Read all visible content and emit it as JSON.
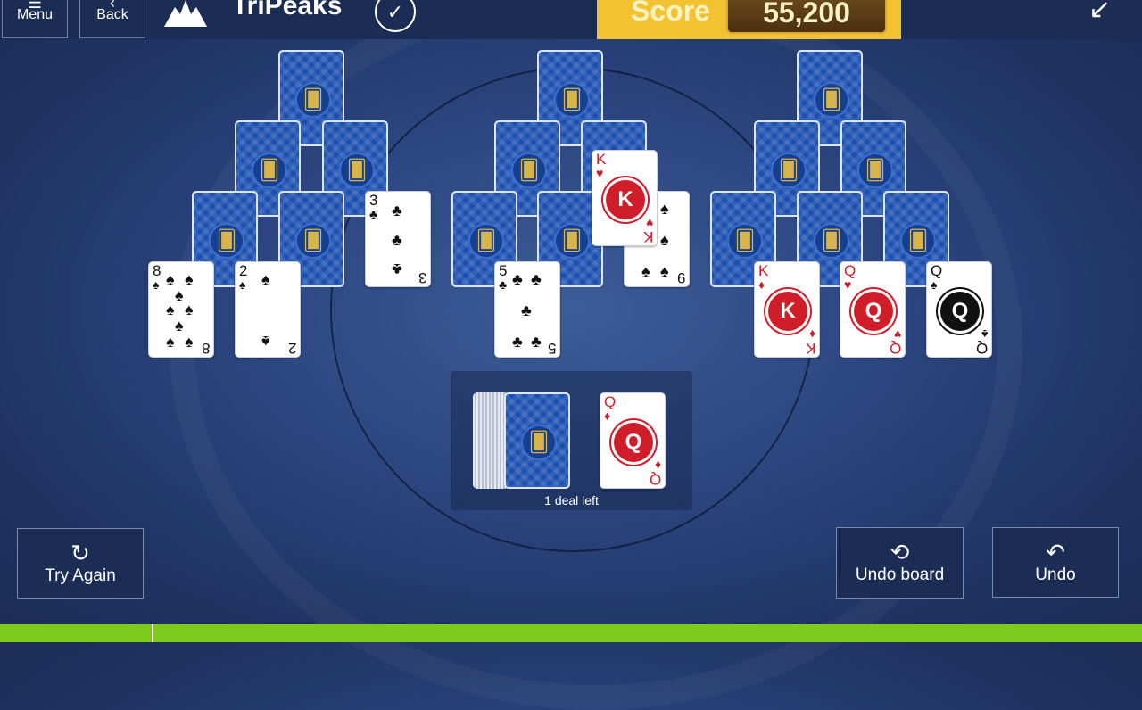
{
  "header": {
    "menu_label": "Menu",
    "back_label": "Back",
    "game_title": "TriPeaks",
    "score_label": "Score",
    "score_value": "55,200"
  },
  "icons": {
    "menu": "hamburger-icon",
    "back": "arrow-left-icon",
    "peaks": "peaks-logo-icon",
    "daily": "checkmark-badge-icon",
    "collapse": "collapse-arrow-icon",
    "card_back": "cards-emblem-icon",
    "try_again": "refresh-icon",
    "undo_board": "undo-board-icon",
    "undo": "undo-arrow-icon"
  },
  "tableau": {
    "cards": [
      {
        "id": "l1",
        "face": "down"
      },
      {
        "id": "l2a",
        "face": "down"
      },
      {
        "id": "l2b",
        "face": "down"
      },
      {
        "id": "l3a",
        "face": "down"
      },
      {
        "id": "l3b",
        "face": "down"
      },
      {
        "id": "l3c",
        "rank": "3",
        "suit": "♣",
        "color": "black"
      },
      {
        "id": "l4a",
        "rank": "8",
        "suit": "♠",
        "color": "black"
      },
      {
        "id": "l4b",
        "rank": "2",
        "suit": "♠",
        "color": "black"
      },
      {
        "id": "m1",
        "face": "down"
      },
      {
        "id": "m2a",
        "face": "down"
      },
      {
        "id": "m2b",
        "face": "down"
      },
      {
        "id": "m3a",
        "face": "down"
      },
      {
        "id": "m3b",
        "face": "down"
      },
      {
        "id": "m3c",
        "rank": "9",
        "suit": "♠",
        "color": "black"
      },
      {
        "id": "mK",
        "rank": "K",
        "suit": "♥",
        "color": "red"
      },
      {
        "id": "m4a",
        "rank": "5",
        "suit": "♣",
        "color": "black"
      },
      {
        "id": "r1",
        "face": "down"
      },
      {
        "id": "r2a",
        "face": "down"
      },
      {
        "id": "r2b",
        "face": "down"
      },
      {
        "id": "r3a",
        "face": "down"
      },
      {
        "id": "r3b",
        "face": "down"
      },
      {
        "id": "r3c",
        "face": "down"
      },
      {
        "id": "r4a",
        "rank": "K",
        "suit": "♦",
        "color": "red"
      },
      {
        "id": "r4b",
        "rank": "Q",
        "suit": "♥",
        "color": "red"
      },
      {
        "id": "r4c",
        "rank": "Q",
        "suit": "♠",
        "color": "black"
      }
    ]
  },
  "waste": {
    "rank": "Q",
    "suit": "♦",
    "color": "red"
  },
  "stock": {
    "deals_left_text": "1 deal left"
  },
  "buttons": {
    "try_again": "Try Again",
    "undo_board": "Undo board",
    "undo": "Undo"
  },
  "colors": {
    "background": "#2c4680",
    "score_bar": "#f2c230",
    "card_back": "#1b4fb0",
    "red_suit": "#d01d2a",
    "goal_bar": "#7ccb1c"
  }
}
